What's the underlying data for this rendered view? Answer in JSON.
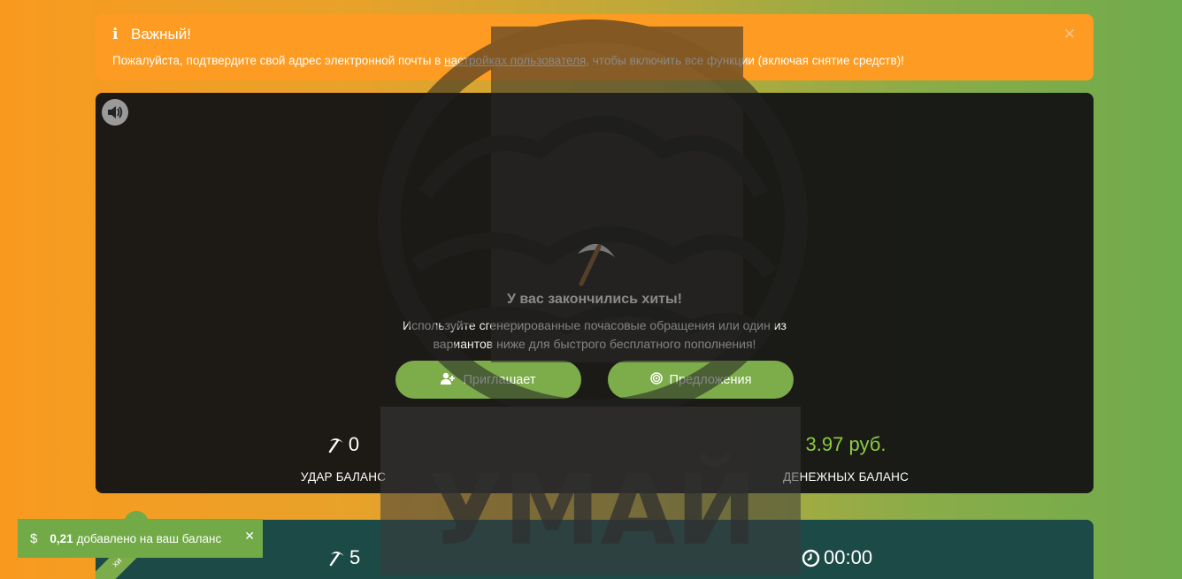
{
  "alert": {
    "title": "Важный!",
    "text_before": "Пожалуйста, подтвердите свой адрес электронной почты в ",
    "link": "настройках пользователя",
    "text_after": ", чтобы включить все функции (включая снятие средств)!",
    "close_icon": "close-icon"
  },
  "mining": {
    "sound_icon": "volume-icon",
    "title": "У вас закончились хиты!",
    "description": "Используйте сгенерированные почасовые обращения или один из вариантов ниже для быстрого бесплатного пополнения!",
    "buttons": [
      {
        "label": "Приглашает",
        "icon": "add-user-icon"
      },
      {
        "label": "Предложения",
        "icon": "target-icon"
      }
    ],
    "hits_value": "0",
    "hits_label": "УДАР БАЛАНС",
    "money_value": "3.97 руб.",
    "money_label": "ДЕНЕЖНЫХ БАЛАНС",
    "accent_color": "#8ccb3e"
  },
  "lower_panel": {
    "hits_value": "5",
    "timer_value": "00:00",
    "ribbon_text": "хи"
  },
  "toast": {
    "amount": "0,21",
    "text": "добавлено на ваш баланс"
  },
  "watermark": {
    "text": "УМАЙ"
  }
}
